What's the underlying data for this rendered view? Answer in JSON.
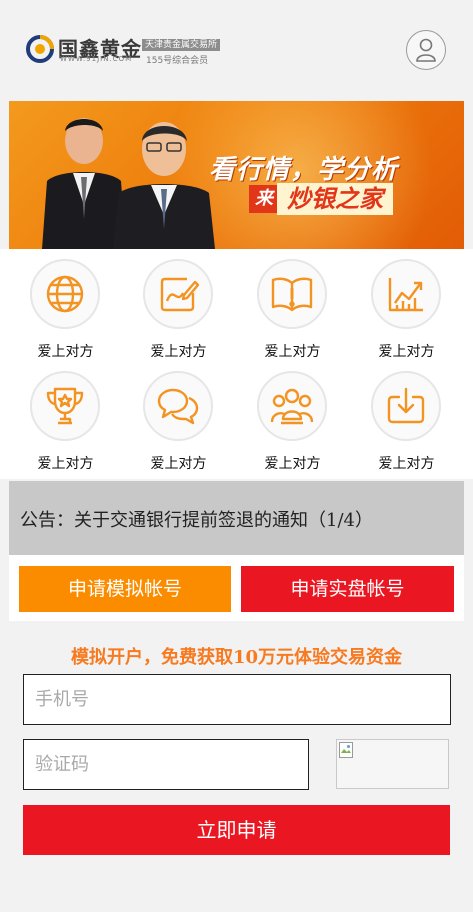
{
  "header": {
    "logo_name": "国鑫黄金",
    "logo_url": "WWW.91JIN.COM",
    "logo_tag_exchange": "天津贵金属交易所",
    "logo_tag_member": "155号综合会员",
    "user_icon": "user-icon"
  },
  "banner": {
    "line1": "看行情，学分析",
    "lai": "来",
    "line2": "炒银之家"
  },
  "grid": {
    "items": [
      {
        "label": "爱上对方",
        "icon": "globe-icon"
      },
      {
        "label": "爱上对方",
        "icon": "edit-chart-icon"
      },
      {
        "label": "爱上对方",
        "icon": "book-icon"
      },
      {
        "label": "爱上对方",
        "icon": "trend-chart-icon"
      },
      {
        "label": "爱上对方",
        "icon": "trophy-icon"
      },
      {
        "label": "爱上对方",
        "icon": "chat-icon"
      },
      {
        "label": "爱上对方",
        "icon": "group-icon"
      },
      {
        "label": "爱上对方",
        "icon": "download-icon"
      }
    ],
    "icon_color": "#f39322"
  },
  "notice": {
    "text": "公告：关于交通银行提前签退的通知（1/4）"
  },
  "apply": {
    "demo_label": "申请模拟帐号",
    "real_label": "申请实盘帐号",
    "demo_color": "#fb8c00",
    "real_color": "#ea1723"
  },
  "form": {
    "promo": "模拟开户，免费获取10万元体验交易资金",
    "phone_placeholder": "手机号",
    "phone_value": "",
    "code_placeholder": "验证码",
    "code_value": "",
    "submit_label": "立即申请"
  }
}
